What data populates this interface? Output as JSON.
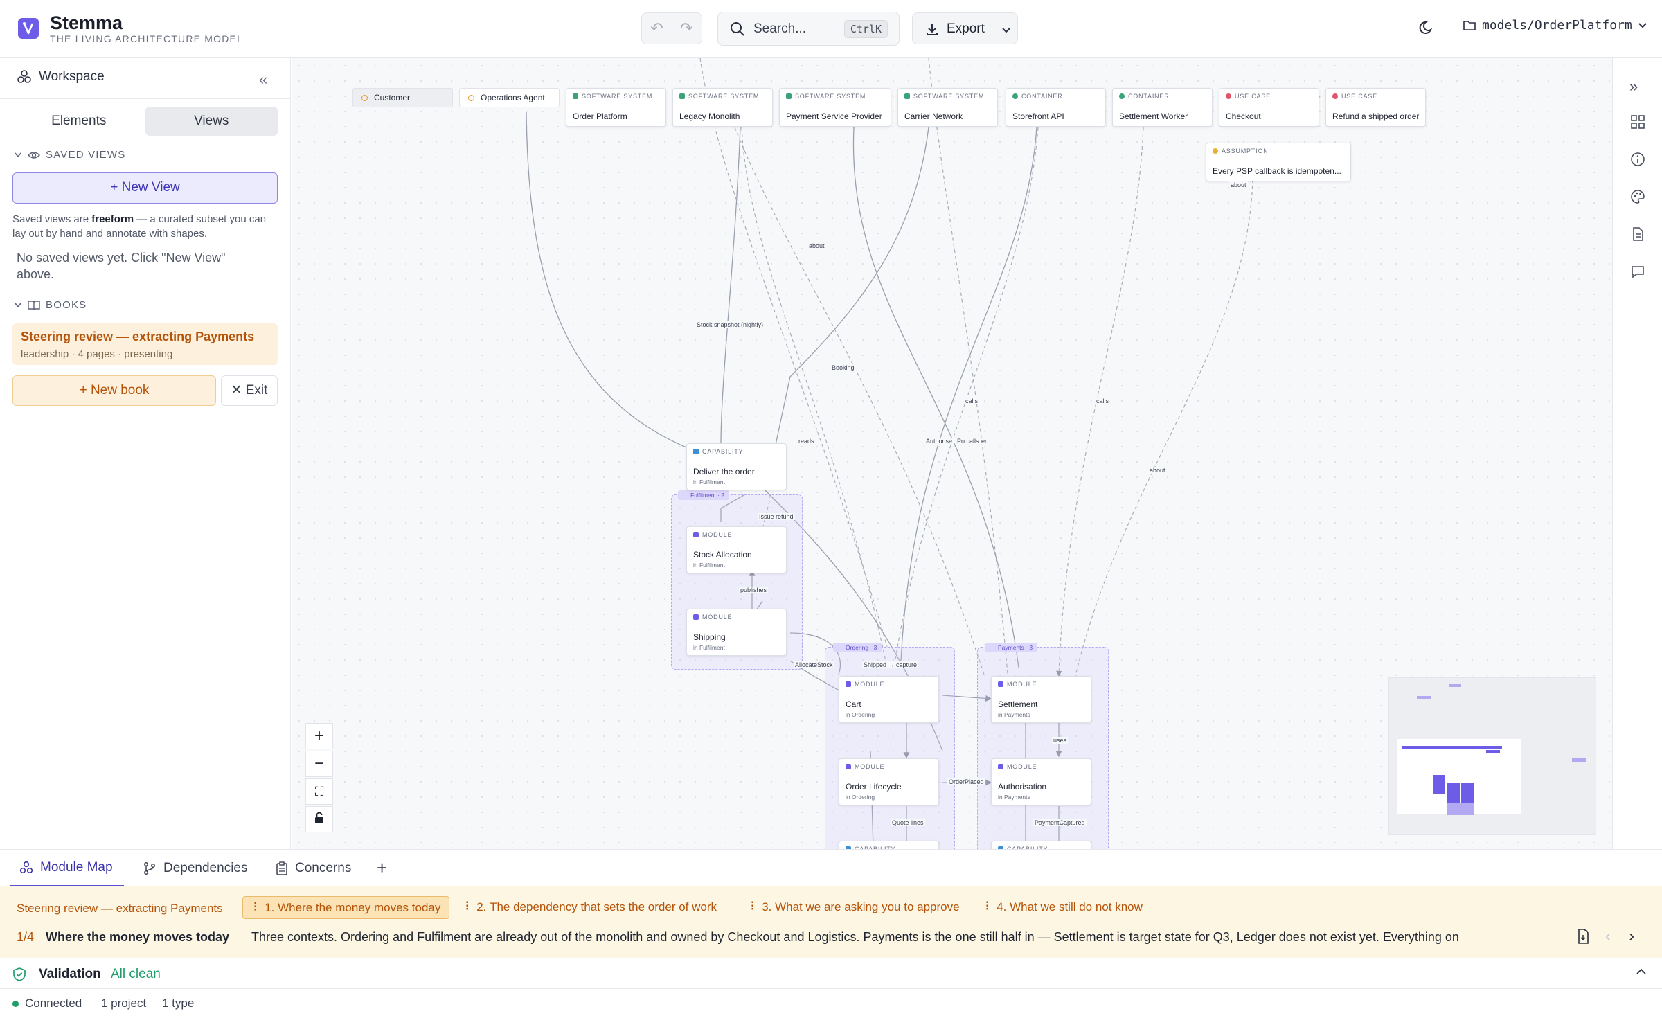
{
  "app": {
    "name": "Stemma",
    "tagline": "THE LIVING ARCHITECTURE MODEL",
    "accent": "#6d5ce8"
  },
  "toolbar": {
    "search_placeholder": "Search...",
    "search_shortcut": "CtrlK",
    "export_label": "Export",
    "model_path": "models/OrderPlatform"
  },
  "sidebar": {
    "title": "Workspace",
    "tabs": [
      "Elements",
      "Views"
    ],
    "active_tab": "Views",
    "saved_views": {
      "heading": "SAVED VIEWS",
      "new_view_label": "New View",
      "note_before": "Saved views are ",
      "note_bold": "freeform",
      "note_after": " — a curated subset you can lay out by hand and annotate with shapes.",
      "empty_text": "No saved views yet. Click \"New View\" above."
    },
    "books": {
      "heading": "BOOKS",
      "items": [
        {
          "title": "Steering review — extracting Payments",
          "meta": "leadership · 4 pages · presenting"
        }
      ],
      "new_book_label": "New book",
      "exit_label": "Exit"
    }
  },
  "canvas": {
    "people": [
      "Customer",
      "Operations Agent"
    ],
    "top_nodes": [
      {
        "kind": "SOFTWARE SYSTEM",
        "name": "Order Platform"
      },
      {
        "kind": "SOFTWARE SYSTEM",
        "name": "Legacy Monolith"
      },
      {
        "kind": "SOFTWARE SYSTEM",
        "name": "Payment Service Provider"
      },
      {
        "kind": "SOFTWARE SYSTEM",
        "name": "Carrier Network"
      },
      {
        "kind": "CONTAINER",
        "name": "Storefront API"
      },
      {
        "kind": "CONTAINER",
        "name": "Settlement Worker"
      },
      {
        "kind": "USE CASE",
        "name": "Checkout"
      },
      {
        "kind": "USE CASE",
        "name": "Refund a shipped order"
      }
    ],
    "assumption": {
      "kind": "ASSUMPTION",
      "name": "Every PSP callback is idempoten..."
    },
    "capability": {
      "kind": "CAPABILITY",
      "name": "Deliver the order",
      "context": "in Fulfilment"
    },
    "groups": [
      {
        "name": "Fulfilment",
        "count": "2"
      },
      {
        "name": "Ordering",
        "count": "3"
      },
      {
        "name": "Payments",
        "count": "3"
      }
    ],
    "modules": [
      {
        "kind": "MODULE",
        "name": "Stock Allocation",
        "context": "in Fulfilment"
      },
      {
        "kind": "MODULE",
        "name": "Shipping",
        "context": "in Fulfilment"
      },
      {
        "kind": "MODULE",
        "name": "Cart",
        "context": "in Ordering"
      },
      {
        "kind": "MODULE",
        "name": "Order Lifecycle",
        "context": "in Ordering"
      },
      {
        "kind": "MODULE",
        "name": "Settlement",
        "context": "in Payments"
      },
      {
        "kind": "MODULE",
        "name": "Authorisation",
        "context": "in Payments"
      }
    ],
    "partial_kind": "CAPABILITY",
    "edge_labels": [
      "about",
      "about",
      "about",
      "Stock snapshot (nightly)",
      "Booking",
      "calls",
      "calls",
      "reads",
      "Authorise",
      "Po calls",
      "er",
      "Issue refund",
      "publishes",
      "AllocateStock",
      "Shipped → capture",
      "uses",
      "OrderPlaced",
      "Quote lines",
      "PaymentCaptured"
    ]
  },
  "bottom": {
    "tabs": [
      "Module Map",
      "Dependencies",
      "Concerns"
    ],
    "active_tab": "Module Map",
    "story": {
      "book_title": "Steering review — extracting Payments",
      "chapters": [
        "1. Where the money moves today",
        "2. The dependency that sets the order of work",
        "3. What we are asking you to approve",
        "4. What we still do not know"
      ],
      "page_indicator": "1/4",
      "page_title": "Where the money moves today",
      "page_body": "Three contexts. Ordering and Fulfilment are already out of the monolith and owned by Checkout and Logistics. Payments is the one still half in — Settlement is target state for Q3, Ledger does not exist yet. Everything on"
    },
    "validation": {
      "label": "Validation",
      "status": "All clean"
    },
    "status": {
      "connection": "Connected",
      "projects": "1 project",
      "types": "1 type"
    }
  }
}
